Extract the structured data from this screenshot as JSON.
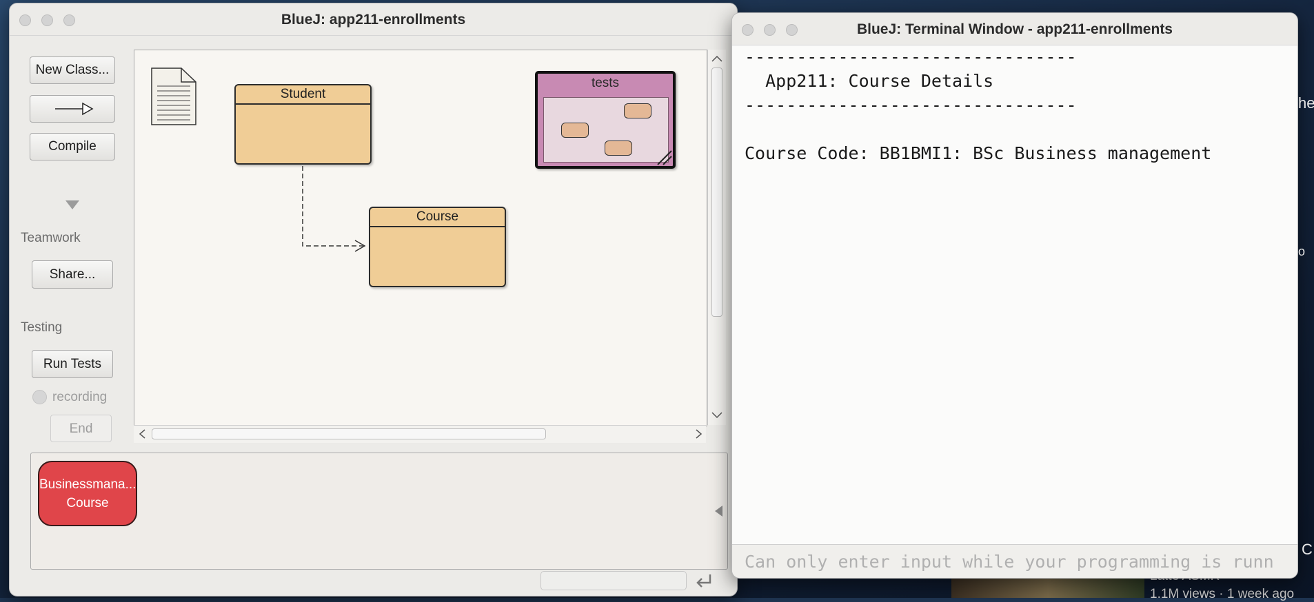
{
  "main_window": {
    "title": "BlueJ:  app211-enrollments",
    "toolbar": {
      "new_class": "New Class...",
      "compile": "Compile",
      "teamwork_label": "Teamwork",
      "share": "Share...",
      "testing_label": "Testing",
      "run_tests": "Run Tests",
      "recording": "recording",
      "end": "End"
    },
    "diagram": {
      "classes": [
        {
          "name": "Student"
        },
        {
          "name": "Course"
        }
      ],
      "package": "tests"
    },
    "object_bench": {
      "objects": [
        {
          "name": "Businessmana...",
          "type": "Course"
        }
      ]
    }
  },
  "terminal_window": {
    "title": "BlueJ: Terminal Window - app211-enrollments",
    "lines": [
      "--------------------------------",
      "  App211: Course Details",
      "--------------------------------",
      "",
      "Course Code: BB1BMI1: BSc Business management"
    ],
    "input_placeholder": "Can only enter input while your programming is runn"
  },
  "background": {
    "video_meta": "1.1M views · 1 week ago",
    "partial_text": "Latte ASMR"
  },
  "colors": {
    "class_fill": "#f0cd96",
    "package_fill": "#c88ab3",
    "object_fill": "#e0454a"
  }
}
